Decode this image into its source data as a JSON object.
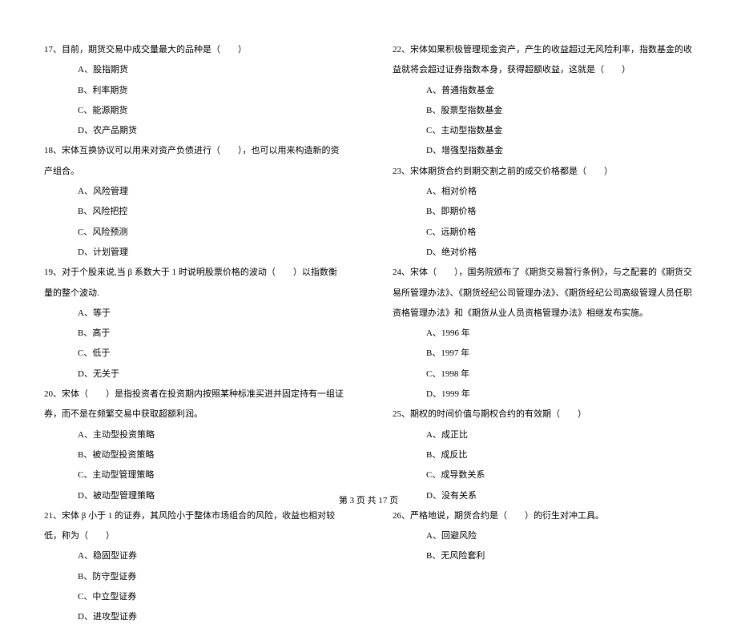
{
  "left_column": [
    {
      "number": "17、",
      "text": "目前，期货交易中成交量最大的品种是（　　）",
      "options": [
        "A、股指期货",
        "B、利率期货",
        "C、能源期货",
        "D、农产品期货"
      ]
    },
    {
      "number": "18、",
      "text": "宋体互换协议可以用来对资产负债进行（　　），也可以用来构造新的资产组合。",
      "options": [
        "A、风险管理",
        "B、风险把控",
        "C、风险预测",
        "D、计划管理"
      ]
    },
    {
      "number": "19、",
      "text": "对于个股来说,当 β 系数大于 1 时说明股票价格的波动（　　）以指数衡量的整个波动.",
      "options": [
        "A、等于",
        "B、高于",
        "C、低于",
        "D、无关于"
      ]
    },
    {
      "number": "20、",
      "text": "宋体（　　）是指投资者在投资期内按照某种标准买进并固定持有一组证券，而不是在频繁交易中获取超额利润。",
      "options": [
        "A、主动型投资策略",
        "B、被动型投资策略",
        "C、主动型管理策略",
        "D、被动型管理策略"
      ]
    },
    {
      "number": "21、",
      "text": "宋体 β 小于 1 的证券，其风险小于整体市场组合的风险，收益也相对较低，称为（　　）",
      "options": [
        "A、稳固型证券",
        "B、防守型证券",
        "C、中立型证券",
        "D、进攻型证券"
      ]
    }
  ],
  "right_column": [
    {
      "number": "22、",
      "text": "宋体如果积极管理现金资产，产生的收益超过无风险利率，指数基金的收益就将会超过证券指数本身，获得超额收益，这就是（　　）",
      "options": [
        "A、普通指数基金",
        "B、股票型指数基金",
        "C、主动型指数基金",
        "D、增强型指数基金"
      ]
    },
    {
      "number": "23、",
      "text": "宋体期货合约到期交割之前的成交价格都是（　　）",
      "options": [
        "A、相对价格",
        "B、即期价格",
        "C、远期价格",
        "D、绝对价格"
      ]
    },
    {
      "number": "24、",
      "text": "宋体（　　），国务院颁布了《期货交易暂行条例》，与之配套的《期货交易所管理办法》、《期货经纪公司管理办法》、《期货经纪公司高级管理人员任职资格管理办法》和《期货从业人员资格管理办法》相继发布实施。",
      "options": [
        "A、1996 年",
        "B、1997 年",
        "C、1998 年",
        "D、1999 年"
      ]
    },
    {
      "number": "25、",
      "text": "期权的时间价值与期权合约的有效期（　　）",
      "options": [
        "A、成正比",
        "B、成反比",
        "C、成导数关系",
        "D、没有关系"
      ]
    },
    {
      "number": "26、",
      "text": "严格地说，期货合约是（　　）的衍生对冲工具。",
      "options": [
        "A、回避风险",
        "B、无风险套利"
      ]
    }
  ],
  "footer": {
    "text": "第 3 页 共 17 页"
  }
}
